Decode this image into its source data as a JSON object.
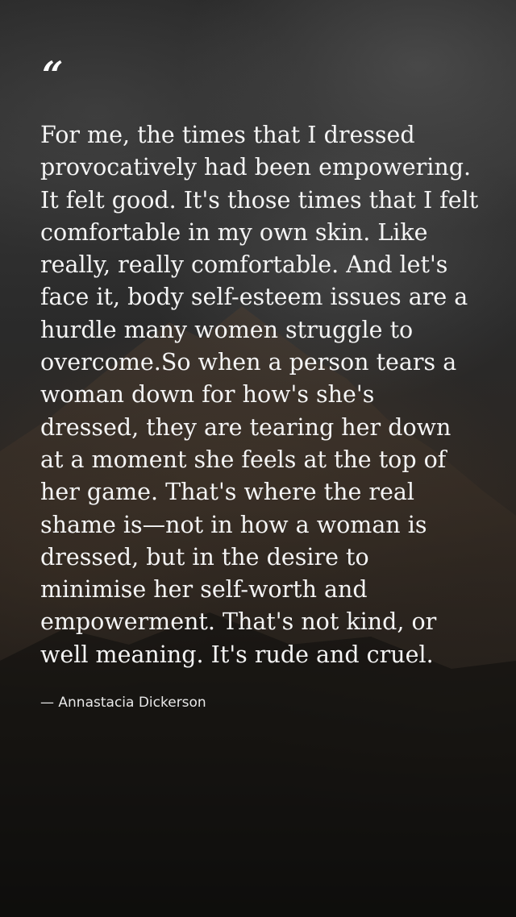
{
  "quote": {
    "mark": "“",
    "text": "For me, the times that I dressed provocatively had been empowering. It felt good. It's those times that I felt comfortable in my own skin. Like really, really comfortable. And let's face it, body self-esteem issues are a hurdle many women struggle to overcome.So when a person tears a woman down for how's she's dressed, they are tearing her down at a moment she feels at the top of her game. That's where the real shame is—not in how a woman is dressed, but in the desire to minimise her self-worth and empowerment. That's not kind, or well meaning. It's rude and cruel.",
    "author": "— Annastacia Dickerson"
  },
  "colors": {
    "text": "#f4f4f4",
    "background": "#2a2a2a"
  }
}
